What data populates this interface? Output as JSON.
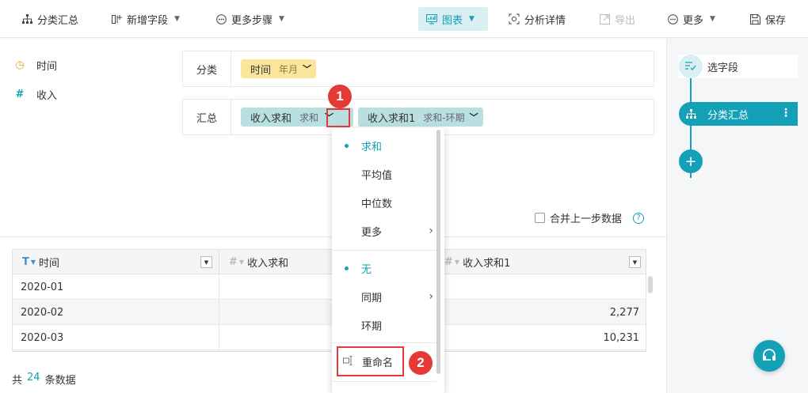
{
  "toolbar": {
    "items": [
      {
        "label": "分类汇总",
        "icon": "hierarchy-icon"
      },
      {
        "label": "新增字段",
        "icon": "add-field-icon",
        "has_caret": true
      },
      {
        "label": "更多步骤",
        "icon": "more-circle-icon",
        "has_caret": true
      },
      {
        "label": "图表",
        "icon": "chart-icon",
        "has_caret": true,
        "active": true
      },
      {
        "label": "分析详情",
        "icon": "analysis-icon"
      },
      {
        "label": "导出",
        "icon": "export-icon",
        "disabled": true
      },
      {
        "label": "更多",
        "icon": "more-circle-icon",
        "has_caret": true
      },
      {
        "label": "保存",
        "icon": "save-icon"
      }
    ]
  },
  "fields": [
    {
      "label": "时间",
      "type_icon": "◷",
      "type": "date"
    },
    {
      "label": "收入",
      "type_icon": "#",
      "type": "number"
    }
  ],
  "config": {
    "group_label": "分类",
    "group_chip": {
      "label": "时间",
      "sub": "年月"
    },
    "summary_label": "汇总",
    "summary_chips": [
      {
        "label": "收入求和",
        "sub": "求和"
      },
      {
        "label": "收入求和1",
        "sub": "求和-环期"
      }
    ]
  },
  "merge_label": "合并上一步数据",
  "help_glyph": "?",
  "table": {
    "columns": [
      {
        "label": "时间",
        "type_icon": "T"
      },
      {
        "label": "收入求和",
        "type_icon": "#"
      },
      {
        "label": "收入求和1",
        "type_icon": "#"
      }
    ],
    "rows": [
      [
        "2020-01",
        "",
        ""
      ],
      [
        "2020-02",
        "",
        "2,277"
      ],
      [
        "2020-03",
        "",
        "10,231"
      ],
      [
        "",
        "",
        ""
      ]
    ]
  },
  "footer": {
    "prefix": "共",
    "count": "24",
    "suffix": "条数据"
  },
  "steps": [
    {
      "label": "选字段",
      "icon": "select-field-icon"
    },
    {
      "label": "分类汇总",
      "icon": "hierarchy-icon"
    }
  ],
  "add_step_glyph": "+",
  "dropdown": {
    "aggregate_items": [
      {
        "label": "求和",
        "selected": true
      },
      {
        "label": "平均值"
      },
      {
        "label": "中位数"
      },
      {
        "label": "更多",
        "submenu": true
      }
    ],
    "compare_items": [
      {
        "label": "无",
        "selected": true
      },
      {
        "label": "同期",
        "submenu": true
      },
      {
        "label": "环期"
      }
    ],
    "rename_label": "重命名"
  },
  "annotations": [
    "1",
    "2"
  ],
  "colors": {
    "accent": "#14a1b7",
    "chip_yellow": "#fbe59a",
    "chip_teal": "#b9dfe0",
    "annotation_red": "#e53935"
  }
}
